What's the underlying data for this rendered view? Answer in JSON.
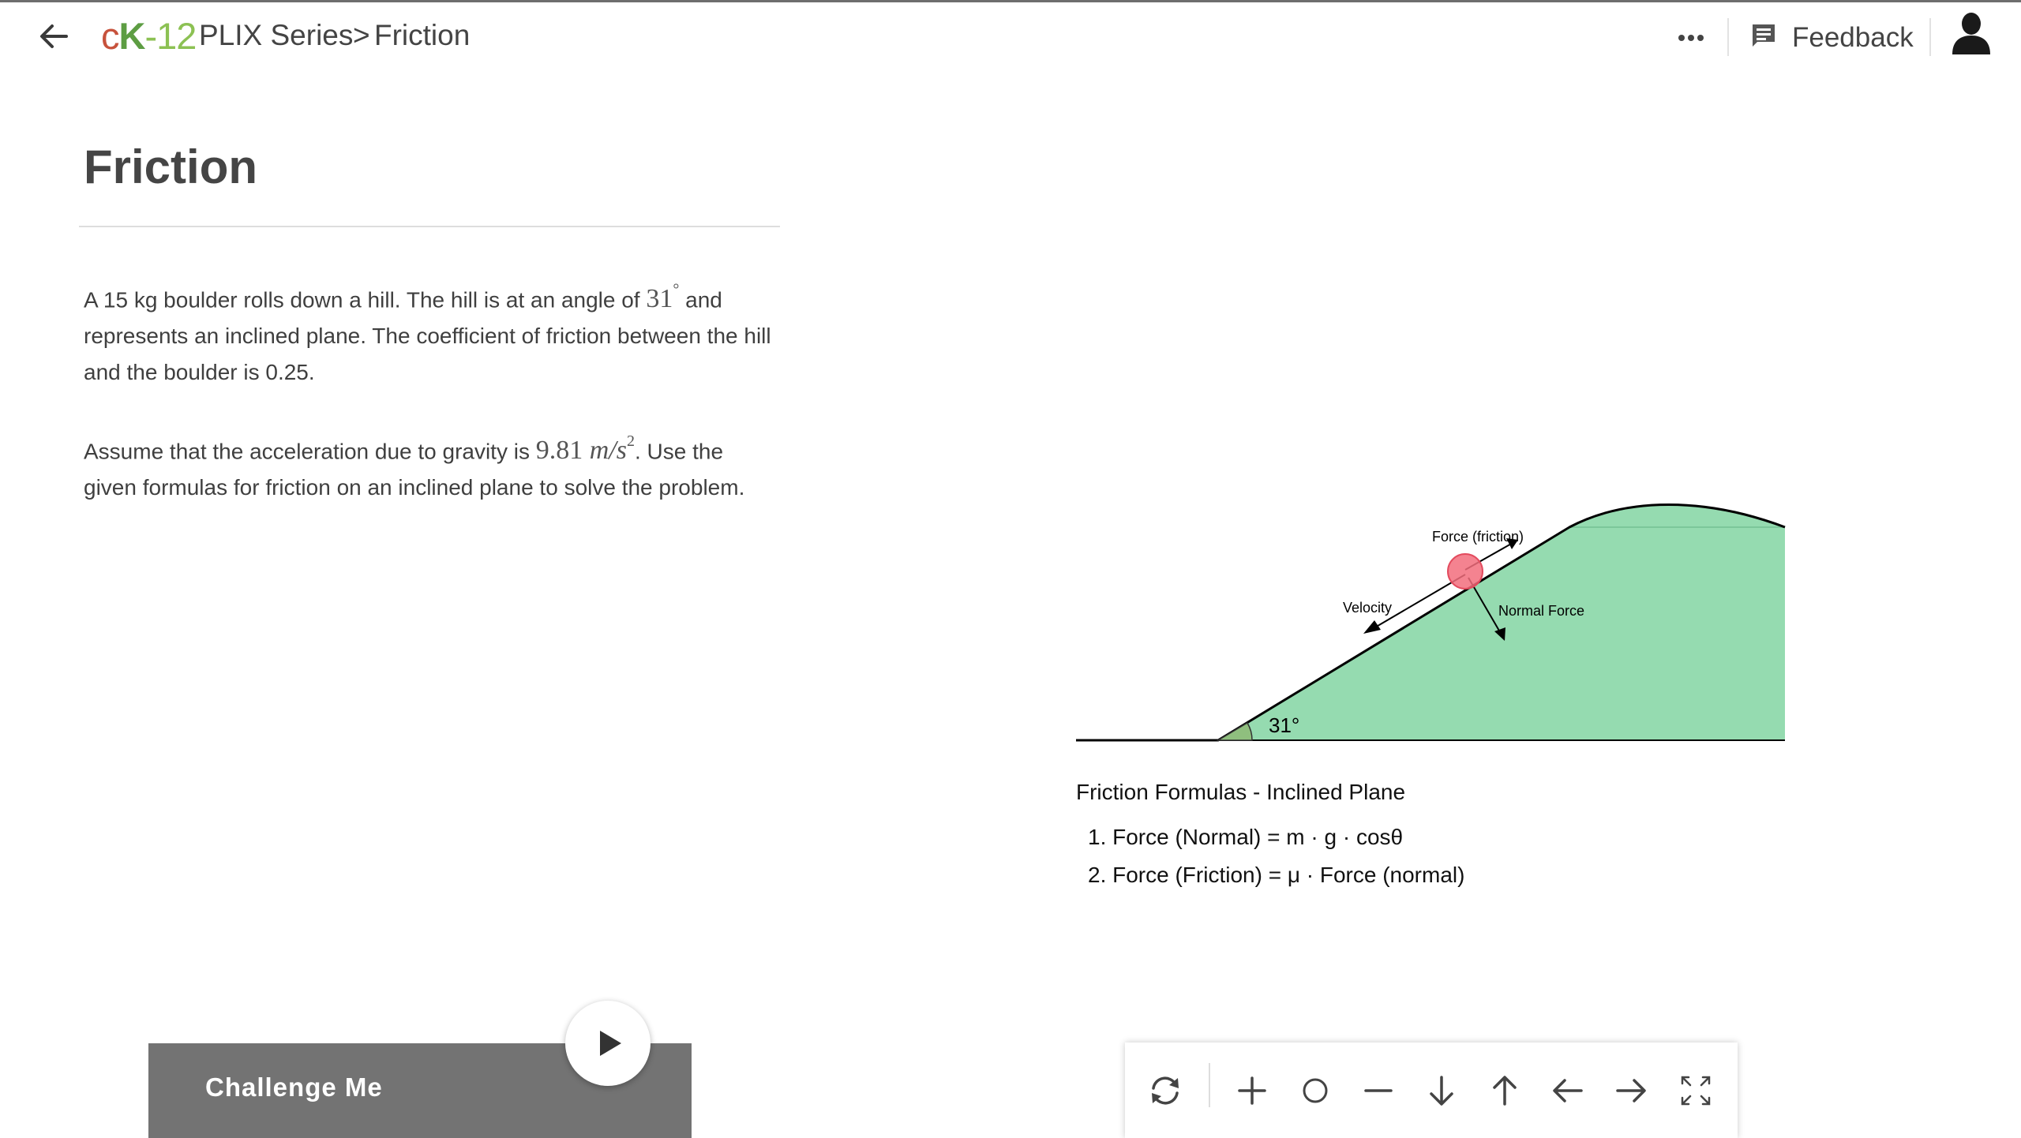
{
  "header": {
    "logo": {
      "c": "c",
      "k": "K",
      "num": "-12"
    },
    "breadcrumb_series": "PLIX Series",
    "breadcrumb_separator": ">",
    "breadcrumb_current": "Friction",
    "feedback_label": "Feedback",
    "icons": [
      "back-arrow-icon",
      "more-dots-icon",
      "feedback-icon",
      "user-avatar-icon"
    ]
  },
  "content": {
    "title": "Friction",
    "paragraph1": {
      "before": " A 15 kg boulder rolls down a hill. The hill is at an angle of ",
      "angle_value": "31",
      "angle_unit": "°",
      "after": " and represents an inclined plane. The coefficient of friction between the hill and the boulder is 0.25."
    },
    "paragraph2": {
      "before": "Assume that the acceleration due to gravity is ",
      "g_value": "9.81",
      "g_unit_base": "m/s",
      "g_unit_exp": "2",
      "after": ". Use the given formulas for friction on an inclined plane to solve the problem."
    }
  },
  "figure": {
    "label_friction": "Force (friction)",
    "label_velocity": "Velocity",
    "label_normal": "Normal Force",
    "label_angle": "31°",
    "colors": {
      "hill": "#95dbb0",
      "ball": "#f26d7d",
      "outline": "#000000"
    }
  },
  "formulas": {
    "title": "Friction Formulas - Inclined Plane",
    "items": [
      "1. Force (Normal) = m · g · cosθ",
      "2. Force (Friction) = μ · Force (normal)"
    ]
  },
  "challenge": {
    "label": "Challenge Me",
    "play_icon": "play-icon"
  },
  "toolbar": {
    "icons": [
      "refresh-icon",
      "plus-icon",
      "circle-icon",
      "minus-icon",
      "arrow-down-icon",
      "arrow-up-icon",
      "arrow-left-icon",
      "arrow-right-icon",
      "fullscreen-icon"
    ]
  }
}
